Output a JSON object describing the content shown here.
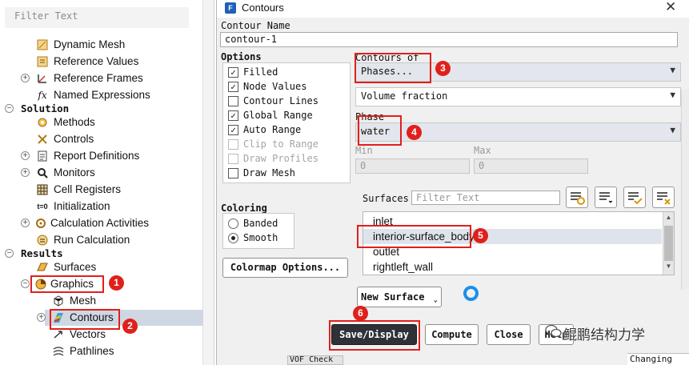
{
  "tree": {
    "filter_placeholder": "Filter Text",
    "items": [
      {
        "label": "Dynamic Mesh",
        "icon": "dynamic-mesh-icon"
      },
      {
        "label": "Reference Values",
        "icon": "reference-values-icon"
      },
      {
        "label": "Reference Frames",
        "icon": "reference-frames-icon"
      },
      {
        "label": "Named Expressions",
        "icon": "fx-icon"
      },
      {
        "label": "Solution",
        "icon": ""
      },
      {
        "label": "Methods",
        "icon": "methods-icon"
      },
      {
        "label": "Controls",
        "icon": "controls-icon"
      },
      {
        "label": "Report Definitions",
        "icon": "report-definitions-icon"
      },
      {
        "label": "Monitors",
        "icon": "monitors-icon"
      },
      {
        "label": "Cell Registers",
        "icon": "cell-registers-icon"
      },
      {
        "label": "Initialization",
        "icon": "initialization-icon"
      },
      {
        "label": "Calculation Activities",
        "icon": "calculation-activities-icon"
      },
      {
        "label": "Run Calculation",
        "icon": "run-calculation-icon"
      },
      {
        "label": "Results",
        "icon": ""
      },
      {
        "label": "Surfaces",
        "icon": "surfaces-icon"
      },
      {
        "label": "Graphics",
        "icon": "graphics-icon"
      },
      {
        "label": "Mesh",
        "icon": "mesh-icon"
      },
      {
        "label": "Contours",
        "icon": "contours-icon"
      },
      {
        "label": "Vectors",
        "icon": "vectors-icon"
      },
      {
        "label": "Pathlines",
        "icon": "pathlines-icon"
      }
    ]
  },
  "dialog": {
    "title": "Contours",
    "app_icon_letter": "F",
    "contour_name_label": "Contour Name",
    "contour_name_value": "contour-1",
    "options_label": "Options",
    "options": [
      {
        "label": "Filled",
        "checked": true,
        "enabled": true
      },
      {
        "label": "Node Values",
        "checked": true,
        "enabled": true
      },
      {
        "label": "Contour Lines",
        "checked": false,
        "enabled": true
      },
      {
        "label": "Global Range",
        "checked": true,
        "enabled": true
      },
      {
        "label": "Auto Range",
        "checked": true,
        "enabled": true
      },
      {
        "label": "Clip to Range",
        "checked": false,
        "enabled": false
      },
      {
        "label": "Draw Profiles",
        "checked": false,
        "enabled": false
      },
      {
        "label": "Draw Mesh",
        "checked": false,
        "enabled": true
      }
    ],
    "coloring_label": "Coloring",
    "coloring": [
      {
        "label": "Banded",
        "selected": false
      },
      {
        "label": "Smooth",
        "selected": true
      }
    ],
    "colormap_button": "Colormap Options...",
    "contours_of_label": "Contours of",
    "contours_of_value": "Phases...",
    "contours_of_sub_value": "Volume fraction",
    "phase_label": "Phase",
    "phase_value": "water",
    "min_label": "Min",
    "min_value": "0",
    "max_label": "Max",
    "max_value": "0",
    "surfaces_label": "Surfaces",
    "surfaces_filter_placeholder": "Filter Text",
    "surfaces": [
      {
        "label": "inlet",
        "selected": false
      },
      {
        "label": "interior-surface_body",
        "selected": true
      },
      {
        "label": "outlet",
        "selected": false
      },
      {
        "label": "rightleft_wall",
        "selected": false
      }
    ],
    "new_surface_button": "New Surface",
    "buttons": {
      "save_display": "Save/Display",
      "compute": "Compute",
      "close": "Close",
      "help": "Help"
    },
    "annotations": [
      "1",
      "2",
      "3",
      "4",
      "5",
      "6"
    ],
    "annotation_color": "#e0201b",
    "background_fragments": {
      "vof_check": "VOF Check",
      "changing": "Changing"
    },
    "watermark": "鲲鹏结构力学"
  }
}
